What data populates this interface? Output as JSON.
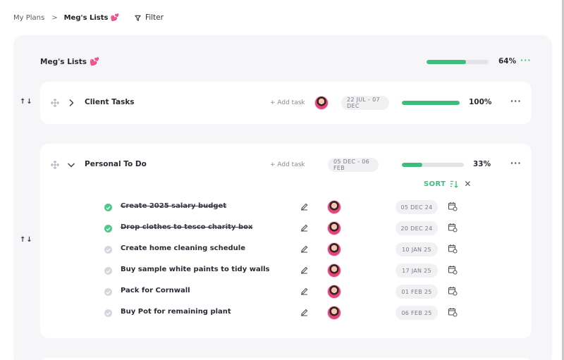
{
  "breadcrumb": {
    "root": "My Plans",
    "separator": ">",
    "current": "Meg's Lists"
  },
  "filter_label": "Filter",
  "panel": {
    "title": "Meg's Lists",
    "progress": 64,
    "progress_label": "64%",
    "menu": "···"
  },
  "lists": [
    {
      "title": "Client Tasks",
      "add_task": "+ Add task",
      "dates": "22 JUL - 07 DEC",
      "progress": 100,
      "progress_label": "100%",
      "menu": "···",
      "expanded": false
    },
    {
      "title": "Personal To Do",
      "add_task": "+ Add task",
      "dates": "05 DEC - 06 FEB",
      "progress": 33,
      "progress_label": "33%",
      "menu": "···",
      "expanded": true
    }
  ],
  "sort_label": "SORT",
  "reorder_arrows": "↑↓",
  "tasks": [
    {
      "text": "Create 2025 salary budget",
      "date": "05 DEC 24",
      "done": true
    },
    {
      "text": "Drop clothes to tesco charity box",
      "date": "20 DEC 24",
      "done": true
    },
    {
      "text": "Create home cleaning schedule",
      "date": "10 JAN 25",
      "done": false
    },
    {
      "text": "Buy sample white paints to tidy walls",
      "date": "17 JAN 25",
      "done": false
    },
    {
      "text": "Pack for Cornwall",
      "date": "01 FEB 25",
      "done": false
    },
    {
      "text": "Buy Pot for remaining plant",
      "date": "06 FEB 25",
      "done": false
    }
  ],
  "icons": {
    "heart": "heart-icon",
    "filter": "filter-icon",
    "move": "move-icon",
    "chevron": "chevron-icon",
    "edit": "edit-icon",
    "calendar": "calendar-icon",
    "sort": "sort-icon",
    "close": "close-icon",
    "check": "check-icon"
  },
  "colors": {
    "accent": "#3dbd7d",
    "heart": "#e2447d",
    "panel_bg": "#f6f6f8"
  }
}
